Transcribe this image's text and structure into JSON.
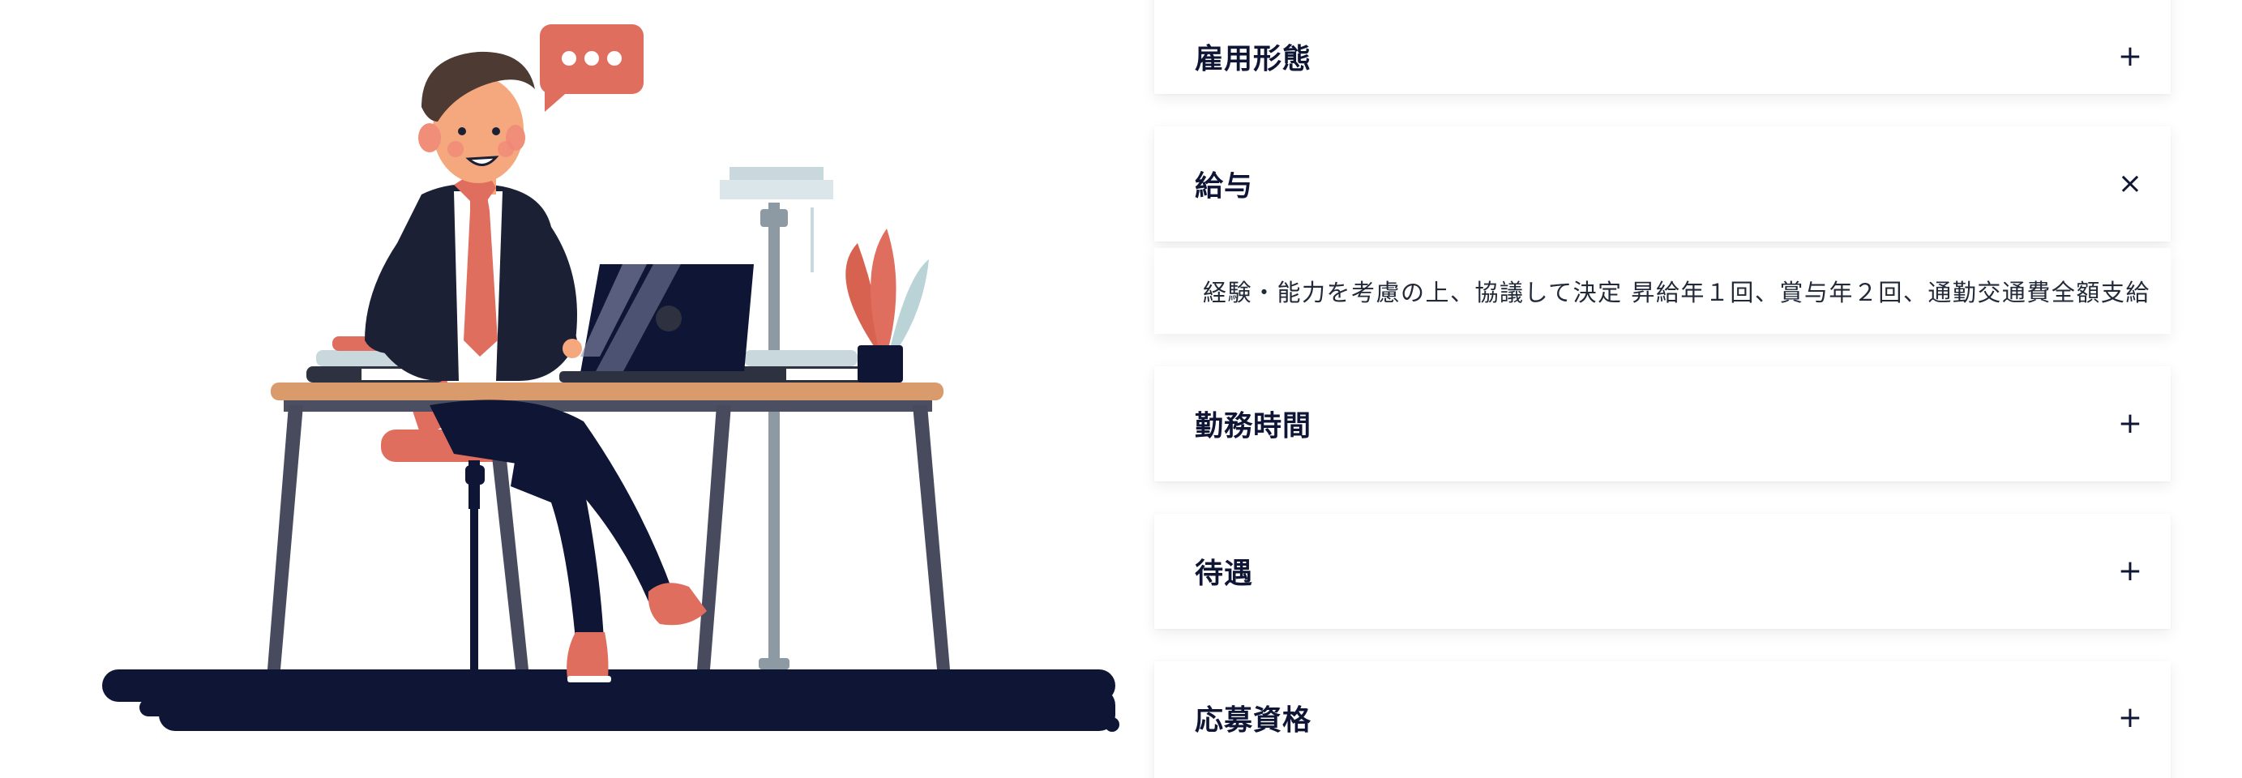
{
  "colors": {
    "navy": "#0f1535",
    "coral": "#e06e5f",
    "desk_top": "#d99a6c",
    "desk_leg": "#474b5d",
    "lamp": "#c9d8dd",
    "plant_green": "#b9d3d6"
  },
  "illustration": {
    "speech_bubble_text": "•••"
  },
  "accordion": {
    "items": [
      {
        "title": "雇用形態",
        "toggle": "+",
        "expanded": false
      },
      {
        "title": "給与",
        "toggle": "×",
        "expanded": true,
        "body": "経験・能力を考慮の上、協議して決定 昇給年１回、賞与年２回、通勤交通費全額支給"
      },
      {
        "title": "勤務時間",
        "toggle": "+",
        "expanded": false
      },
      {
        "title": "待遇",
        "toggle": "+",
        "expanded": false
      },
      {
        "title": "応募資格",
        "toggle": "+",
        "expanded": false
      }
    ]
  }
}
